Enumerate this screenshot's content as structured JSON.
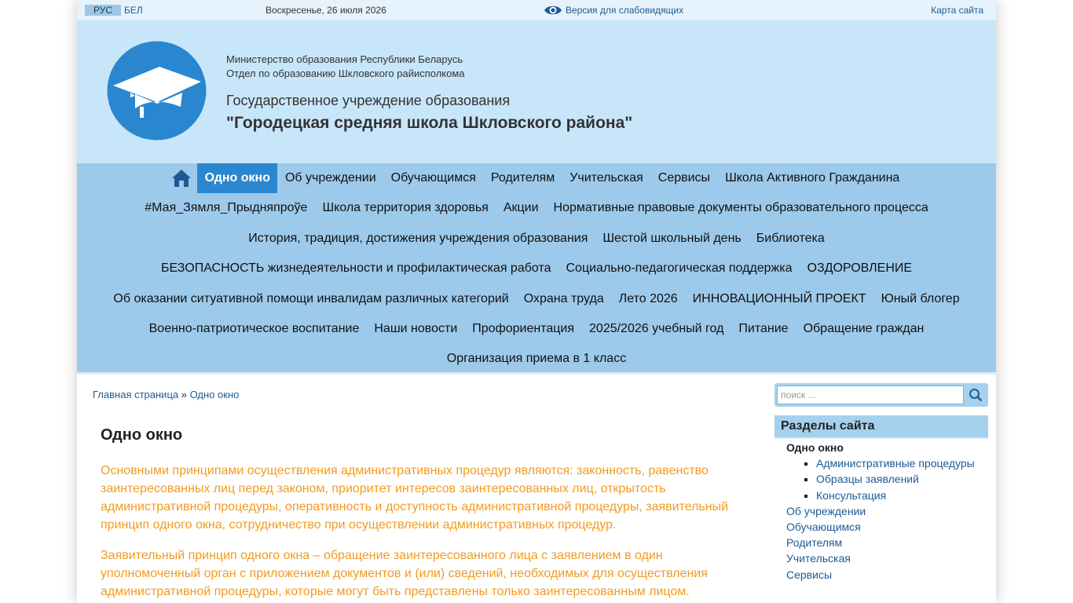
{
  "topbar": {
    "lang_ru": "РУС",
    "lang_be": "БЕЛ",
    "date": "Воскресенье, 26 июля 2026",
    "low_vision": "Версия для слабовидящих",
    "sitemap": "Карта сайта"
  },
  "header": {
    "ministry": "Министерство образования Республики Беларусь",
    "department": "Отдел по образованию Шкловского райисполкома",
    "institution_type": "Государственное учреждение образования",
    "institution_name": "\"Городецкая средняя школа Шкловского района\""
  },
  "nav": {
    "rows": [
      [
        "Одно окно",
        "Об учреждении",
        "Обучающимся",
        "Родителям",
        "Учительская",
        "Сервисы",
        "Школа Активного Гражданина"
      ],
      [
        "#Мая_Зямля_Прыдняпроўе",
        "Школа территория здоровья",
        "Акции",
        "Нормативные правовые документы образовательного процесса"
      ],
      [
        "История, традиция, достижения учреждения образования",
        "Шестой школьный день",
        "Библиотека"
      ],
      [
        "БЕЗОПАСНОСТЬ жизнедеятельности и профилактическая работа",
        "Социально-педагогическая поддержка",
        "ОЗДОРОВЛЕНИЕ"
      ],
      [
        "Об оказании ситуативной помощи инвалидам различных категорий",
        "Охрана труда",
        "Лето 2026",
        "ИННОВАЦИОННЫЙ ПРОЕКТ",
        "Юный блогер"
      ],
      [
        "Военно-патриотическое воспитание",
        "Наши новости",
        "Профориентация",
        "2025/2026 учебный год",
        "Питание",
        "Обращение граждан"
      ],
      [
        "Организация приема в 1 класс"
      ]
    ],
    "active": "Одно окно"
  },
  "breadcrumb": {
    "home": "Главная страница",
    "sep": "»",
    "current": "Одно окно"
  },
  "content": {
    "title": "Одно окно",
    "p1": "Основными принципами осуществления административных процедур являются: законность, равенство заинтересованных лиц перед законом, приоритет интересов заинтересованных лиц, открытость административной процедуры, оперативность и доступность административной процедуры, заявительный принцип одного окна, сотрудничество при осуществлении административных процедур.",
    "p2": "Заявительный принцип одного окна – обращение заинтересованного лица с заявлением в один уполномоченный орган с приложением документов и (или) сведений, необходимых для осуществления административной процедуры, которые могут быть представлены только заинтересованным лицом."
  },
  "sidebar": {
    "search_placeholder": "поиск ...",
    "heading": "Разделы сайта",
    "current": "Одно окно",
    "subitems": [
      "Административные процедуры",
      "Образцы заявлений",
      "Консультация"
    ],
    "items": [
      "Об учреждении",
      "Обучающимся",
      "Родителям",
      "Учительская",
      "Сервисы"
    ]
  },
  "colors": {
    "accent": "#2a87cf",
    "nav_bg": "#9dcaeb",
    "header_bg": "#c8e6fa",
    "paragraph_text": "#f29b1f",
    "link": "#1d5a96"
  }
}
